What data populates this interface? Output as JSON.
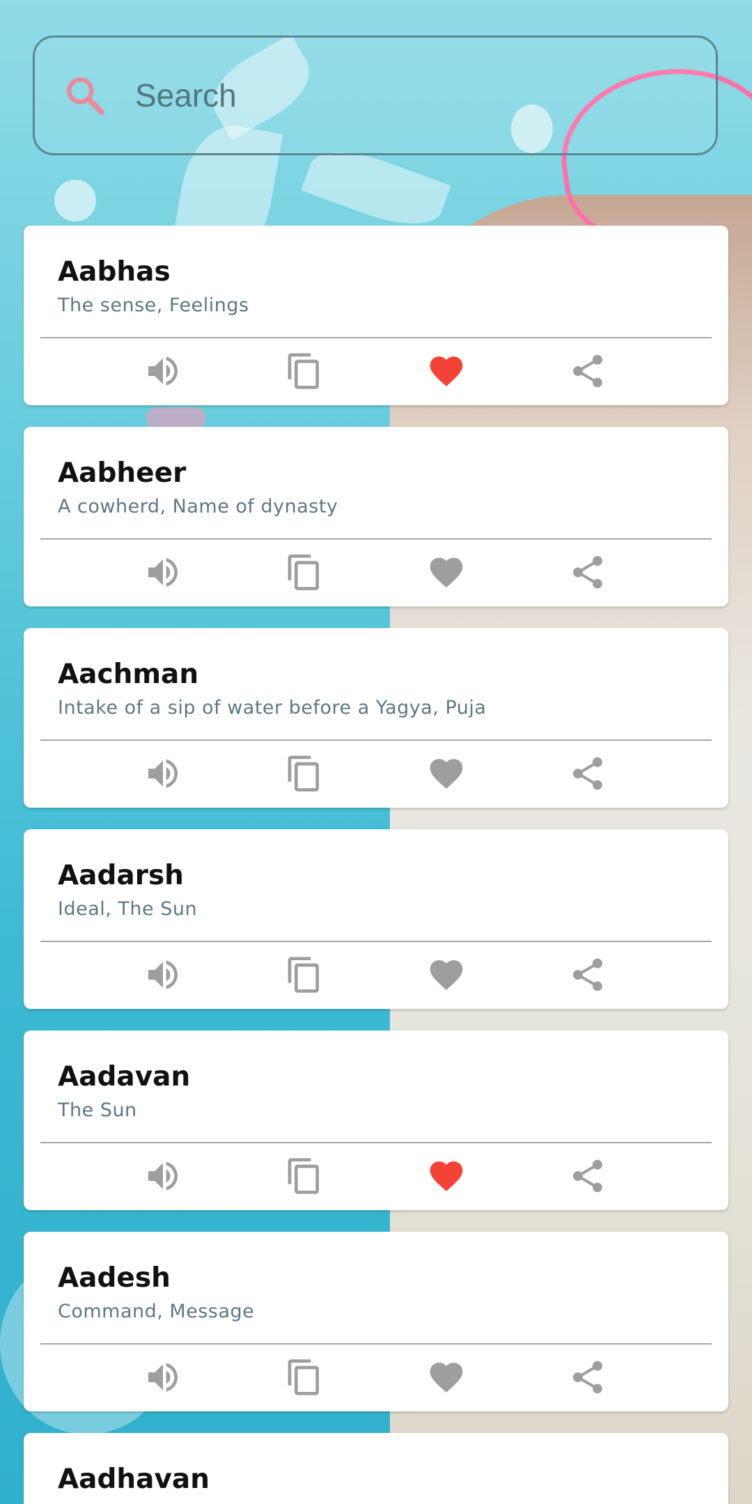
{
  "search": {
    "placeholder": "Search"
  },
  "colors": {
    "favorite_active": "#f44336",
    "favorite_inactive": "#9e9e9e",
    "icon_gray": "#9e9e9e",
    "meaning_text": "#5d7884",
    "search_border": "#5a8891"
  },
  "icons": {
    "search": "search-icon",
    "speak": "volume-icon",
    "copy": "copy-icon",
    "favorite": "heart-icon",
    "share": "share-icon"
  },
  "names": [
    {
      "name": "Aabhas",
      "meaning": "The sense, Feelings",
      "favorite": true
    },
    {
      "name": "Aabheer",
      "meaning": "A cowherd, Name of dynasty",
      "favorite": false
    },
    {
      "name": "Aachman",
      "meaning": "Intake of a sip of water before a Yagya, Puja",
      "favorite": false
    },
    {
      "name": "Aadarsh",
      "meaning": "Ideal, The Sun",
      "favorite": false
    },
    {
      "name": "Aadavan",
      "meaning": "The Sun",
      "favorite": true
    },
    {
      "name": "Aadesh",
      "meaning": "Command, Message",
      "favorite": false
    },
    {
      "name": "Aadhavan",
      "meaning": "",
      "favorite": false
    }
  ]
}
